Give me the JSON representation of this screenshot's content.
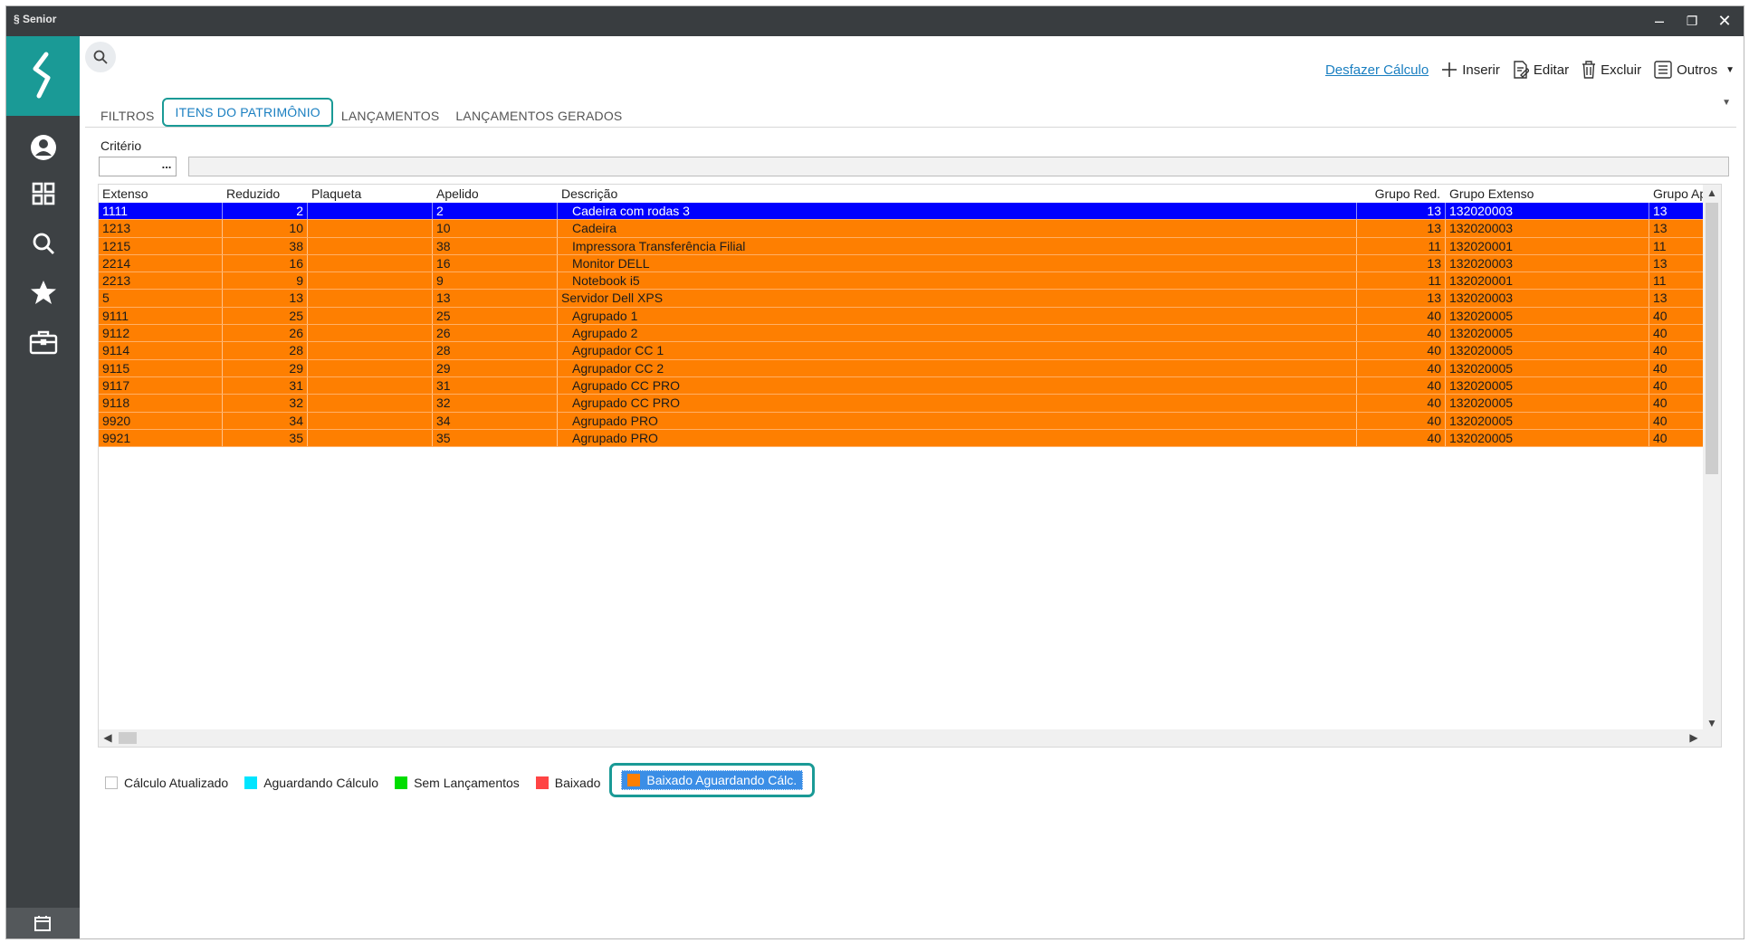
{
  "window": {
    "app_name": "Senior",
    "controls": {
      "minimize": "–",
      "restore": "❐",
      "close": "✕"
    }
  },
  "sidebar": {
    "items": [
      {
        "icon": "user-icon"
      },
      {
        "icon": "apps-grid-icon"
      },
      {
        "icon": "search-icon"
      },
      {
        "icon": "star-icon"
      },
      {
        "icon": "briefcase-icon"
      }
    ]
  },
  "toolbar": {
    "undo_calc": "Desfazer Cálculo",
    "insert": "Inserir",
    "edit": "Editar",
    "delete": "Excluir",
    "others": "Outros"
  },
  "tabs": [
    {
      "label": "FILTROS",
      "active": false
    },
    {
      "label": "ITENS DO PATRIMÔNIO",
      "active": true
    },
    {
      "label": "LANÇAMENTOS",
      "active": false
    },
    {
      "label": "LANÇAMENTOS GERADOS",
      "active": false
    }
  ],
  "criteria": {
    "label": "Critério",
    "value": "",
    "button": "..."
  },
  "table": {
    "columns": [
      "Extenso",
      "Reduzido",
      "Plaqueta",
      "Apelido",
      "Descrição",
      "Grupo Red.",
      "Grupo Extenso",
      "Grupo Apel"
    ],
    "rows": [
      [
        "1111",
        "2",
        "",
        "2",
        "Cadeira com rodas 3",
        "13",
        "132020003",
        "13"
      ],
      [
        "1213",
        "10",
        "",
        "10",
        "Cadeira",
        "13",
        "132020003",
        "13"
      ],
      [
        "1215",
        "38",
        "",
        "38",
        "Impressora Transferência Filial",
        "11",
        "132020001",
        "11"
      ],
      [
        "2214",
        "16",
        "",
        "16",
        "Monitor DELL",
        "13",
        "132020003",
        "13"
      ],
      [
        "2213",
        "9",
        "",
        "9",
        "Notebook i5",
        "11",
        "132020001",
        "11"
      ],
      [
        "5",
        "13",
        "",
        "13",
        "Servidor Dell XPS",
        "13",
        "132020003",
        "13"
      ],
      [
        "9111",
        "25",
        "",
        "25",
        "Agrupado 1",
        "40",
        "132020005",
        "40"
      ],
      [
        "9112",
        "26",
        "",
        "26",
        "Agrupado 2",
        "40",
        "132020005",
        "40"
      ],
      [
        "9114",
        "28",
        "",
        "28",
        "Agrupador CC 1",
        "40",
        "132020005",
        "40"
      ],
      [
        "9115",
        "29",
        "",
        "29",
        "Agrupador CC 2",
        "40",
        "132020005",
        "40"
      ],
      [
        "9117",
        "31",
        "",
        "31",
        "Agrupado CC PRO",
        "40",
        "132020005",
        "40"
      ],
      [
        "9118",
        "32",
        "",
        "32",
        "Agrupado CC PRO",
        "40",
        "132020005",
        "40"
      ],
      [
        "9920",
        "34",
        "",
        "34",
        "Agrupado PRO",
        "40",
        "132020005",
        "40"
      ],
      [
        "9921",
        "35",
        "",
        "35",
        "Agrupado PRO",
        "40",
        "132020005",
        "40"
      ]
    ],
    "desc_indented": [
      true,
      true,
      true,
      true,
      true,
      false,
      true,
      true,
      true,
      true,
      true,
      true,
      true,
      true
    ],
    "selected_row": 0,
    "row_color": "#fe7f01",
    "selected_color": "#0000ff"
  },
  "legend": [
    {
      "label": "Cálculo Atualizado",
      "color": "#ffffff"
    },
    {
      "label": "Aguardando Cálculo",
      "color": "#00e5ff"
    },
    {
      "label": "Sem Lançamentos",
      "color": "#00dd00"
    },
    {
      "label": "Baixado",
      "color": "#ff4444"
    },
    {
      "label": "Baixado Aguardando Cálc.",
      "color": "#fe7f01",
      "selected": true
    }
  ]
}
